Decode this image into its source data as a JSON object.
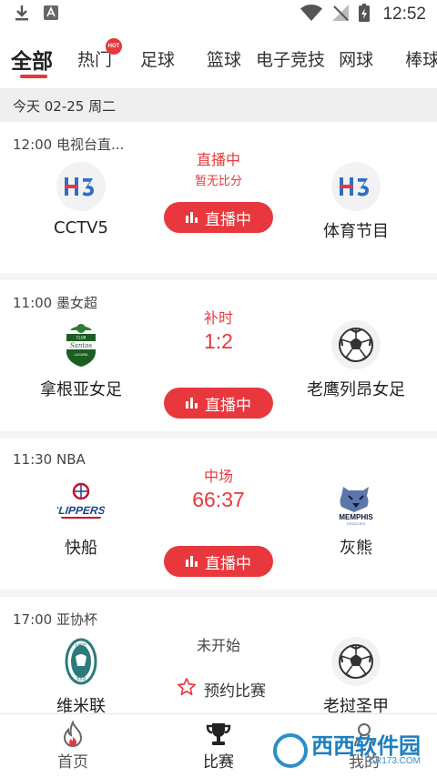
{
  "status_bar": {
    "time": "12:52",
    "icons": [
      "download-icon",
      "text-app-icon",
      "wifi-icon",
      "no-signal-icon",
      "battery-charging-icon"
    ]
  },
  "tabs": [
    {
      "label": "全部",
      "active": true
    },
    {
      "label": "热门",
      "badge": "HOT"
    },
    {
      "label": "足球"
    },
    {
      "label": "篮球"
    },
    {
      "label": "电子竞技"
    },
    {
      "label": "网球"
    },
    {
      "label": "棒球"
    }
  ],
  "date_bar": "今天 02-25 周二",
  "matches": [
    {
      "league": "12:00 电视台直...",
      "home": {
        "name": "CCTV5",
        "logo": "h3-logo-icon"
      },
      "away": {
        "name": "体育节目",
        "logo": "h3-logo-icon"
      },
      "status": "直播中",
      "sub": "暂无比分",
      "score": "",
      "action": "直播中"
    },
    {
      "league": "11:00 墨女超",
      "home": {
        "name": "拿根亚女足",
        "logo": "santos-laguna-crest-icon"
      },
      "away": {
        "name": "老鹰列昂女足",
        "logo": "soccer-ball-icon"
      },
      "status": "补时",
      "sub": "",
      "score": "1:2",
      "action": "直播中"
    },
    {
      "league": "11:30 NBA",
      "home": {
        "name": "快船",
        "logo": "clippers-logo-icon"
      },
      "away": {
        "name": "灰熊",
        "logo": "grizzlies-logo-icon"
      },
      "status": "中场",
      "sub": "",
      "score": "66:37",
      "action": "直播中"
    },
    {
      "league": "17:00 亚协杯",
      "home": {
        "name": "维米联",
        "logo": "club-crest-icon"
      },
      "away": {
        "name": "老挝圣甲",
        "logo": "soccer-ball-icon"
      },
      "status": "未开始",
      "sub": "",
      "score": "",
      "action": "预约比赛"
    }
  ],
  "bottom_nav": [
    {
      "label": "首页",
      "icon": "flame-icon"
    },
    {
      "label": "比赛",
      "icon": "trophy-icon",
      "active": true
    },
    {
      "label": "我的",
      "icon": "user-icon"
    }
  ],
  "watermark": {
    "title": "西西软件园",
    "url": "CR173.COM"
  },
  "colors": {
    "accent": "#e8383d",
    "background": "#f4f4f4"
  }
}
